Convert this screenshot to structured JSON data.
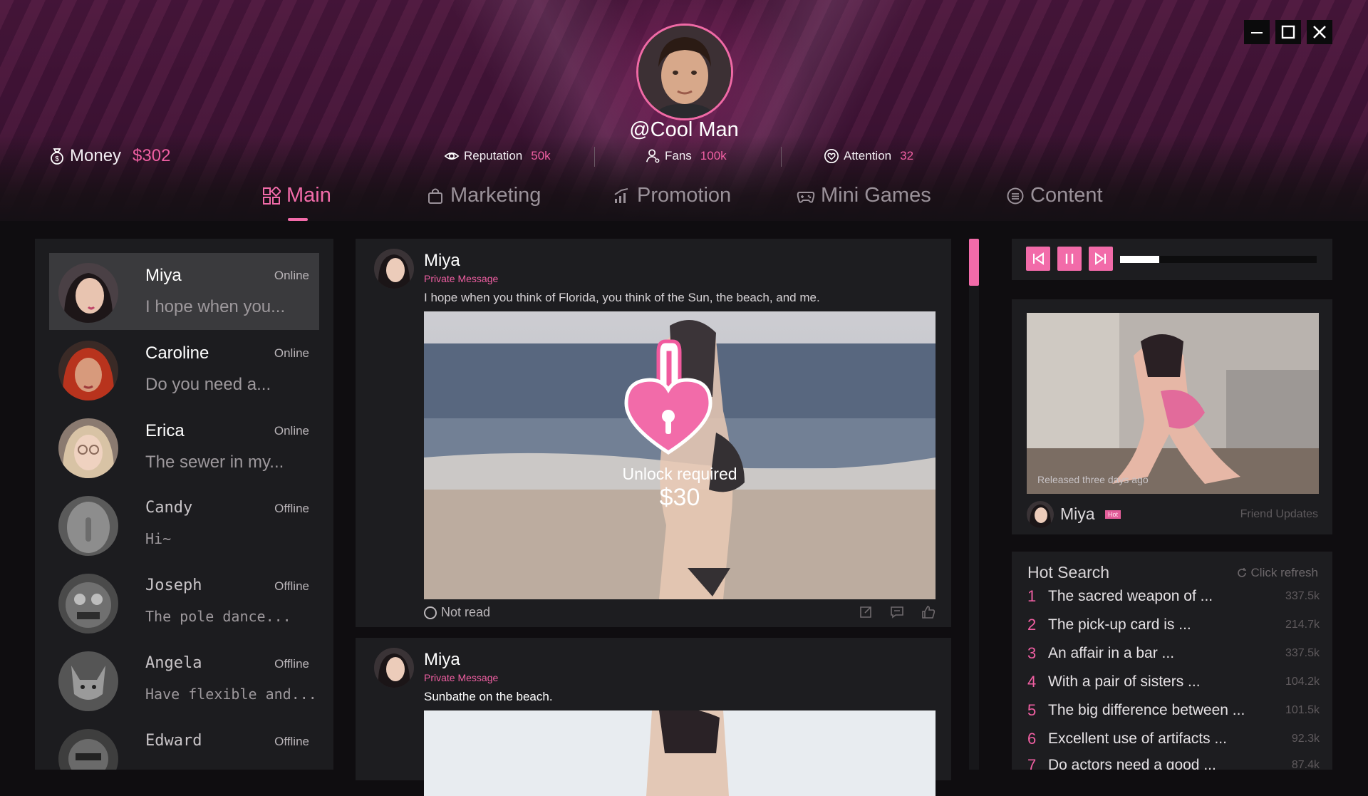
{
  "window_controls": {
    "minimize": "minimize",
    "maximize": "maximize",
    "close": "close"
  },
  "profile": {
    "username": "@Cool Man",
    "stats": {
      "money_label": "Money",
      "money_value": "$302",
      "reputation_label": "Reputation",
      "reputation_value": "50k",
      "fans_label": "Fans",
      "fans_value": "100k",
      "attention_label": "Attention",
      "attention_value": "32"
    }
  },
  "nav": {
    "tabs": [
      {
        "label": "Main",
        "icon": "grid-icon",
        "active": true
      },
      {
        "label": "Marketing",
        "icon": "shopping-bag-icon",
        "active": false
      },
      {
        "label": "Promotion",
        "icon": "signal-bars-icon",
        "active": false
      },
      {
        "label": "Mini Games",
        "icon": "gamepad-icon",
        "active": false
      },
      {
        "label": "Content",
        "icon": "list-circle-icon",
        "active": false
      }
    ]
  },
  "chats": [
    {
      "name": "Miya",
      "status": "Online",
      "preview": "I hope when you...",
      "selected": true
    },
    {
      "name": "Caroline",
      "status": "Online",
      "preview": "Do you need a...",
      "selected": false
    },
    {
      "name": "Erica",
      "status": "Online",
      "preview": "The sewer in my...",
      "selected": false
    },
    {
      "name": "Candy",
      "status": "Offline",
      "preview": "Hi~",
      "selected": false
    },
    {
      "name": "Joseph",
      "status": "Offline",
      "preview": "The pole dance...",
      "selected": false
    },
    {
      "name": "Angela",
      "status": "Offline",
      "preview": "Have flexible and...",
      "selected": false
    },
    {
      "name": "Edward",
      "status": "Offline",
      "preview": "",
      "selected": false
    }
  ],
  "posts": [
    {
      "author": "Miya",
      "tag": "Private Message",
      "text": "I hope when you think of Florida, you think of the Sun, the beach, and me.",
      "unlock_label": "Unlock required",
      "unlock_price": "$30",
      "read_status": "Not read"
    },
    {
      "author": "Miya",
      "tag": "Private Message",
      "text": "Sunbathe on the beach."
    }
  ],
  "music": {
    "progress": 0.2
  },
  "friend_update": {
    "released": "Released three days ago",
    "name": "Miya",
    "badge": "Hot",
    "label": "Friend Updates"
  },
  "hot_search": {
    "title": "Hot Search",
    "refresh_label": "Click refresh",
    "items": [
      {
        "rank": "1",
        "text": "The sacred weapon of ...",
        "count": "337.5k"
      },
      {
        "rank": "2",
        "text": "The pick-up card is ...",
        "count": "214.7k"
      },
      {
        "rank": "3",
        "text": "An affair in a bar ...",
        "count": "337.5k"
      },
      {
        "rank": "4",
        "text": "With a pair of sisters ...",
        "count": "104.2k"
      },
      {
        "rank": "5",
        "text": "The big difference between ...",
        "count": "101.5k"
      },
      {
        "rank": "6",
        "text": "Excellent use of artifacts ...",
        "count": "92.3k"
      },
      {
        "rank": "7",
        "text": "Do actors need a good ...",
        "count": "87.4k"
      }
    ]
  },
  "colors": {
    "accent": "#f26ba9",
    "panel": "#1d1d20",
    "background": "#0f0d10"
  }
}
